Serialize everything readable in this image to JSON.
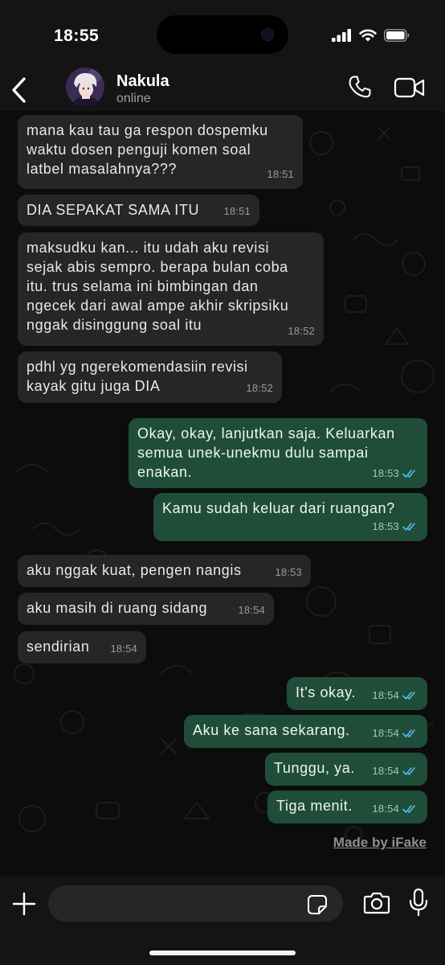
{
  "status_bar": {
    "time": "18:55"
  },
  "header": {
    "contact_name": "Nakula",
    "contact_status": "online"
  },
  "messages": [
    {
      "direction": "in",
      "text": "mana kau tau ga respon dospemku\nwaktu dosen penguji komen soal\nlatbel masalahnya???",
      "time": "18:51"
    },
    {
      "direction": "in",
      "text": "DIA SEPAKAT SAMA ITU",
      "time": "18:51"
    },
    {
      "direction": "in",
      "text": "maksudku kan... itu udah aku revisi\nsejak abis sempro. berapa bulan coba\nitu. trus selama ini bimbingan dan\nngecek dari awal ampe akhir skripsiku\nnggak disinggung soal itu",
      "time": "18:52"
    },
    {
      "direction": "in",
      "text": "pdhl yg ngerekomendasiin revisi\nkayak gitu juga DIA",
      "time": "18:52"
    },
    {
      "direction": "out",
      "text": "Okay, okay, lanjutkan saja. Keluarkan\nsemua unek-unekmu dulu sampai\nenakan.",
      "time": "18:53",
      "read": true
    },
    {
      "direction": "out",
      "text": "Kamu sudah keluar dari ruangan?",
      "time": "18:53",
      "read": true
    },
    {
      "direction": "in",
      "text": "aku nggak kuat, pengen nangis",
      "time": "18:53"
    },
    {
      "direction": "in",
      "text": "aku masih di ruang sidang",
      "time": "18:54"
    },
    {
      "direction": "in",
      "text": "sendirian",
      "time": "18:54"
    },
    {
      "direction": "out",
      "text": "It's okay.",
      "time": "18:54",
      "read": true
    },
    {
      "direction": "out",
      "text": "Aku ke sana sekarang.",
      "time": "18:54",
      "read": true
    },
    {
      "direction": "out",
      "text": "Tunggu, ya.",
      "time": "18:54",
      "read": true
    },
    {
      "direction": "out",
      "text": "Tiga menit.",
      "time": "18:54",
      "read": true
    }
  ],
  "watermark": "Made by iFake",
  "input": {
    "value": ""
  },
  "colors": {
    "incoming_bubble": "#262626",
    "outgoing_bubble": "#1f4d3a",
    "read_ticks": "#53bdeb",
    "background": "#0c0c0c"
  },
  "icons": [
    "back-chevron-icon",
    "phone-icon",
    "video-camera-icon",
    "plus-icon",
    "sticker-icon",
    "camera-icon",
    "microphone-icon",
    "signal-icon",
    "wifi-icon",
    "battery-icon"
  ]
}
